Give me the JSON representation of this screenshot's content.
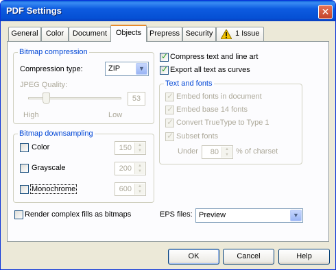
{
  "window": {
    "title": "PDF Settings",
    "close_glyph": "✕"
  },
  "tabs": [
    {
      "label": "General"
    },
    {
      "label": "Color"
    },
    {
      "label": "Document"
    },
    {
      "label": "Objects"
    },
    {
      "label": "Prepress"
    },
    {
      "label": "Security"
    },
    {
      "label": "1 Issue"
    }
  ],
  "bitmap_compression": {
    "legend": "Bitmap compression",
    "type_label": "Compression type:",
    "type_value": "ZIP",
    "jpeg_label": "JPEG Quality:",
    "jpeg_value": "53",
    "high_label": "High",
    "low_label": "Low"
  },
  "bitmap_downsampling": {
    "legend": "Bitmap downsampling",
    "color_label": "Color",
    "color_value": "150",
    "grayscale_label": "Grayscale",
    "grayscale_value": "200",
    "monochrome_label": "Monochrome",
    "monochrome_value": "600"
  },
  "render_complex_label": "Render complex fills as bitmaps",
  "compress_text_label": "Compress text and line art",
  "export_curves_label": "Export all text as curves",
  "text_fonts": {
    "legend": "Text and fonts",
    "embed_fonts_label": "Embed fonts in document",
    "embed_base14_label": "Embed base 14 fonts",
    "convert_truetype_label": "Convert TrueType to Type 1",
    "subset_fonts_label": "Subset fonts",
    "under_label": "Under",
    "under_value": "80",
    "of_charset_label": "% of charset"
  },
  "eps": {
    "label": "EPS files:",
    "value": "Preview"
  },
  "buttons": {
    "ok": "OK",
    "cancel": "Cancel",
    "help": "Help"
  },
  "colors": {
    "titlebar": "#0553d6",
    "face": "#ece9d8",
    "legend": "#0046d5",
    "check": "#21a121",
    "warning": "#f2c200"
  }
}
